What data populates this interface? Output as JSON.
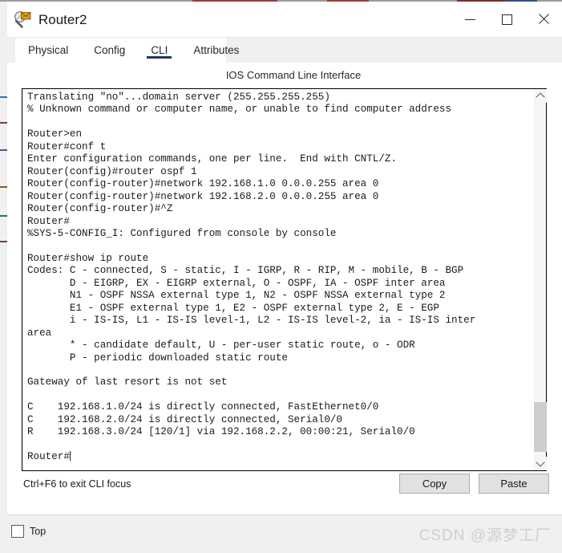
{
  "window": {
    "title": "Router2",
    "icon": "packet-tracer-inspect-icon",
    "controls": {
      "minimize": "—",
      "maximize": "☐",
      "close": "✕"
    }
  },
  "tabs": [
    {
      "label": "Physical",
      "active": false
    },
    {
      "label": "Config",
      "active": false
    },
    {
      "label": "CLI",
      "active": true
    },
    {
      "label": "Attributes",
      "active": false
    }
  ],
  "panel": {
    "heading": "IOS Command Line Interface"
  },
  "terminal": {
    "text": "Translating \"no\"...domain server (255.255.255.255)\n% Unknown command or computer name, or unable to find computer address\n\nRouter>en\nRouter#conf t\nEnter configuration commands, one per line.  End with CNTL/Z.\nRouter(config)#router ospf 1\nRouter(config-router)#network 192.168.1.0 0.0.0.255 area 0\nRouter(config-router)#network 192.168.2.0 0.0.0.255 area 0\nRouter(config-router)#^Z\nRouter#\n%SYS-5-CONFIG_I: Configured from console by console\n\nRouter#show ip route\nCodes: C - connected, S - static, I - IGRP, R - RIP, M - mobile, B - BGP\n       D - EIGRP, EX - EIGRP external, O - OSPF, IA - OSPF inter area\n       N1 - OSPF NSSA external type 1, N2 - OSPF NSSA external type 2\n       E1 - OSPF external type 1, E2 - OSPF external type 2, E - EGP\n       i - IS-IS, L1 - IS-IS level-1, L2 - IS-IS level-2, ia - IS-IS inter\narea\n       * - candidate default, U - per-user static route, o - ODR\n       P - periodic downloaded static route\n\nGateway of last resort is not set\n\nC    192.168.1.0/24 is directly connected, FastEthernet0/0\nC    192.168.2.0/24 is directly connected, Serial0/0\nR    192.168.3.0/24 [120/1] via 192.168.2.2, 00:00:21, Serial0/0\n\n",
    "prompt": "Router#",
    "scrollbar": {
      "up_arrow": "chevron-up",
      "down_arrow": "chevron-down"
    }
  },
  "footer": {
    "hint": "Ctrl+F6 to exit CLI focus",
    "copy_label": "Copy",
    "paste_label": "Paste"
  },
  "bottom": {
    "top_checkbox_label": "Top",
    "top_checked": false,
    "watermark": "CSDN @源梦工厂"
  },
  "colors": {
    "accent": "#1f3864",
    "window_bg": "#ffffff",
    "chrome_bg": "#f0f0f0",
    "button_bg": "#e1e1e1",
    "terminal_text": "#1a1a1a",
    "scrollbar_thumb": "#cdcdcd",
    "watermark": "#cfcfcf"
  }
}
